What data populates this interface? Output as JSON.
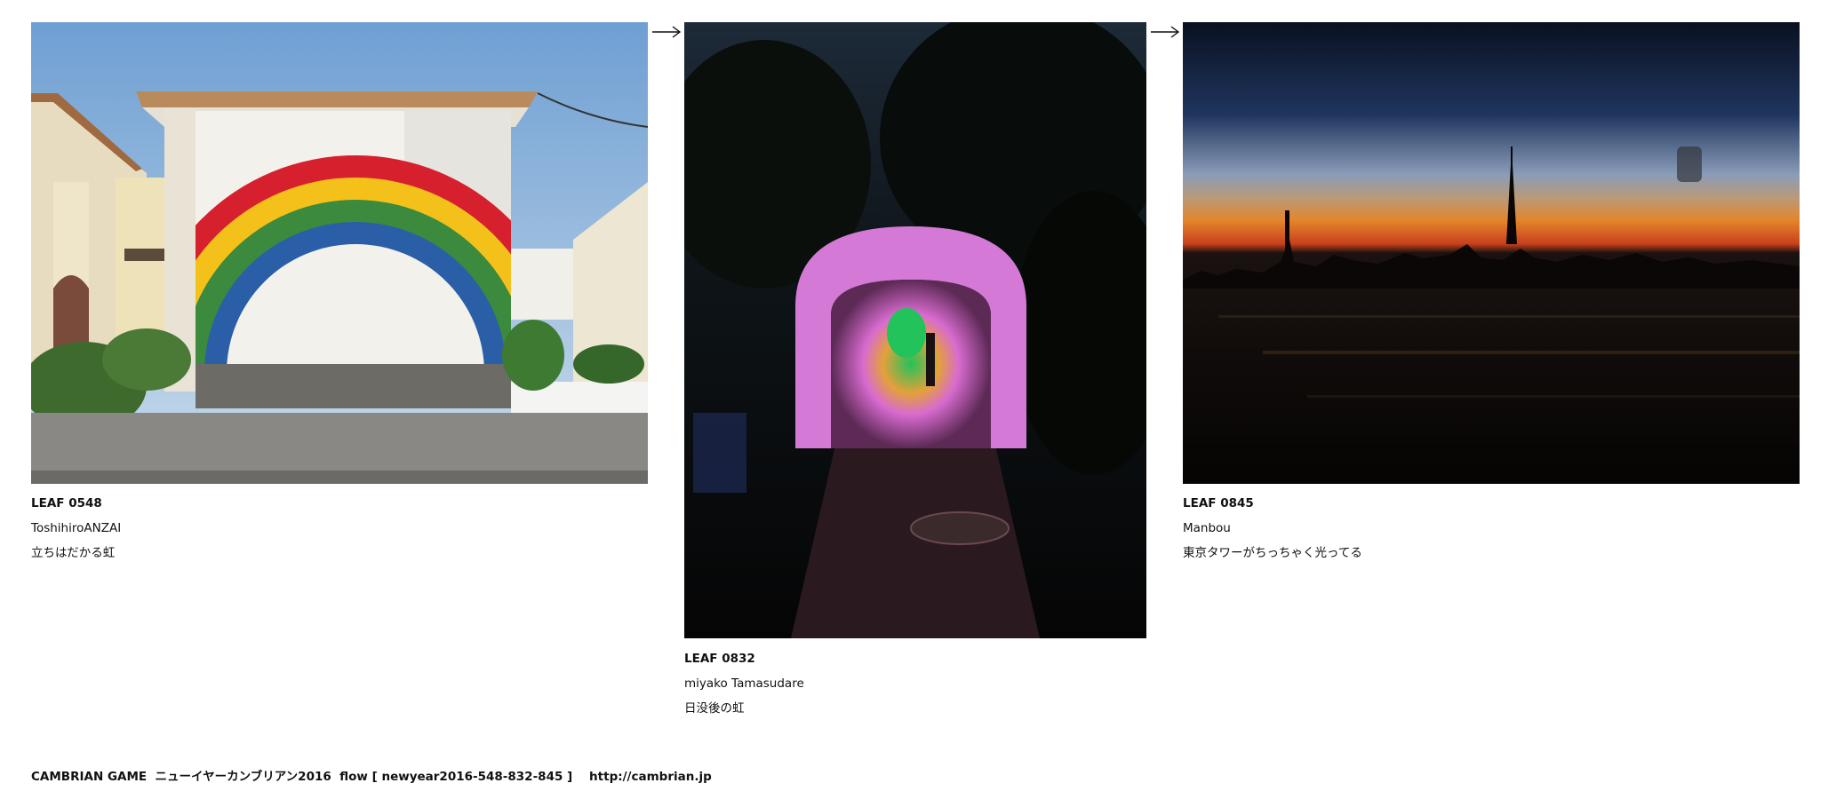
{
  "leaves": [
    {
      "id": "LEAF 0548",
      "author": "ToshihiroANZAI",
      "caption": "立ちはだかる虹",
      "image": "rainbow-mural-photo"
    },
    {
      "id": "LEAF 0832",
      "author": "miyako Tamasudare",
      "caption": "日没後の虹",
      "image": "light-tunnel-photo"
    },
    {
      "id": "LEAF 0845",
      "author": "Manbou",
      "caption": "東京タワーがちっちゃく光ってる",
      "image": "skyline-dusk-photo"
    }
  ],
  "arrows": [
    "arrow-right-icon",
    "arrow-right-icon"
  ],
  "footer": {
    "label": "CAMBRIAN GAME  ニューイヤーカンブリアン2016  flow [ newyear2016-548-832-845 ]",
    "url": "http://cambrian.jp"
  }
}
